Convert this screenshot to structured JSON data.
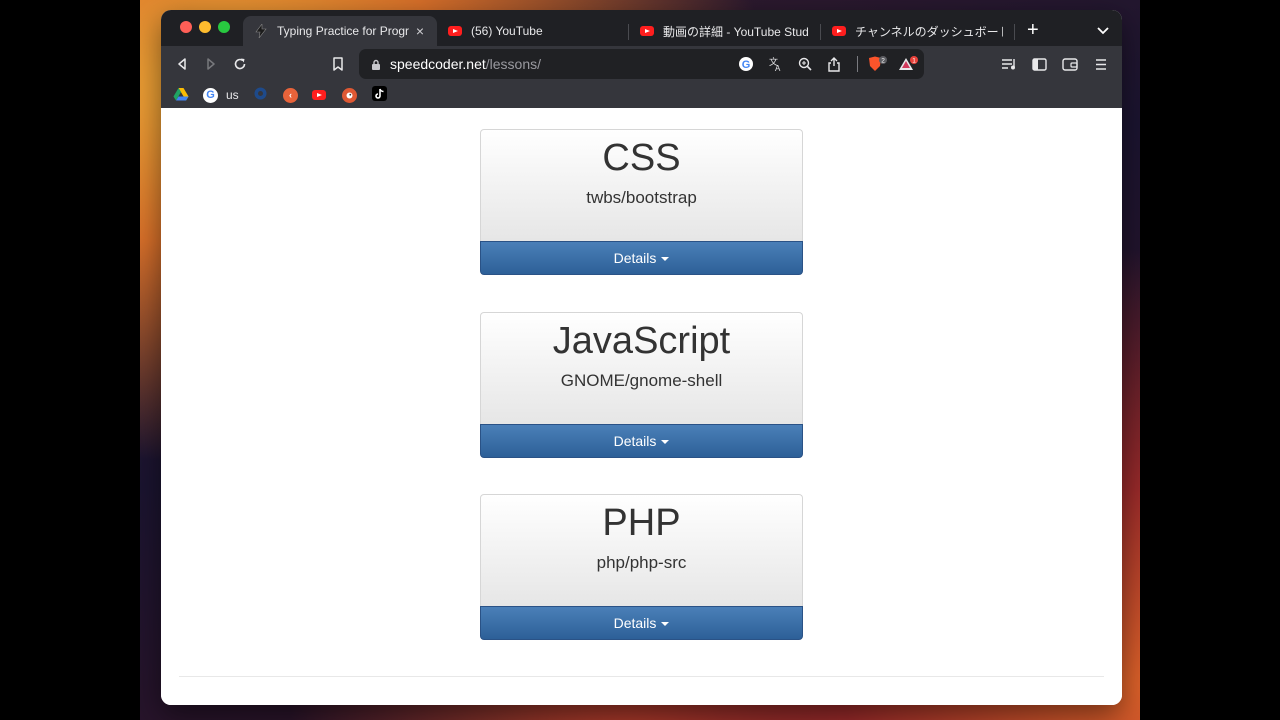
{
  "browser": {
    "tabs": [
      {
        "title": "Typing Practice for Programmers",
        "icon": "bolt-icon",
        "active": true
      },
      {
        "title": "(56) YouTube",
        "icon": "youtube-icon",
        "active": false
      },
      {
        "title": "動画の詳細 - YouTube Studio",
        "icon": "youtube-icon",
        "active": false
      },
      {
        "title": "チャンネルのダッシュボード - YouTube Studio",
        "icon": "youtube-icon",
        "active": false
      }
    ],
    "new_tab_label": "+",
    "close_tab_label": "×",
    "address": {
      "domain": "speedcoder.net",
      "path": "/lessons/"
    },
    "badges": {
      "brave_shields_count": "2",
      "rewards_count": "1"
    },
    "bookmarks": [
      {
        "label": "",
        "icon": "google-drive-icon"
      },
      {
        "label": "us",
        "icon": "google-icon"
      },
      {
        "label": "",
        "icon": "gear-bookmark-icon"
      },
      {
        "label": "",
        "icon": "back-orange-icon"
      },
      {
        "label": "",
        "icon": "youtube-icon"
      },
      {
        "label": "",
        "icon": "duckduckgo-icon"
      },
      {
        "label": "",
        "icon": "tiktok-icon"
      }
    ]
  },
  "lessons": [
    {
      "language": "CSS",
      "repo": "twbs/bootstrap",
      "button": "Details"
    },
    {
      "language": "JavaScript",
      "repo": "GNOME/gnome-shell",
      "button": "Details"
    },
    {
      "language": "PHP",
      "repo": "php/php-src",
      "button": "Details"
    }
  ],
  "colors": {
    "accent_button": "#3a6ea8",
    "tab_bar": "#1f2024",
    "toolbar": "#35363c"
  }
}
